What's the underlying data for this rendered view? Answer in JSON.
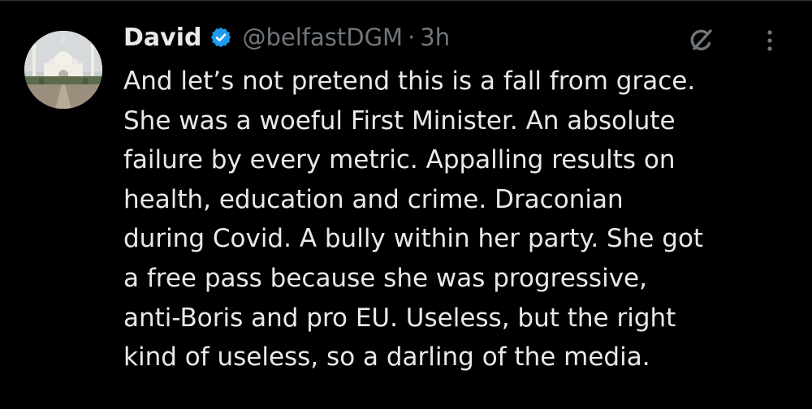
{
  "tweet": {
    "author_name": "David",
    "handle": "@belfastDGM",
    "separator": "·",
    "time": "3h",
    "verified": true,
    "lines": [
      "And let’s not pretend this is a fall from grace.",
      "She was a woeful First Minister. An absolute",
      "failure by every metric. Appalling results on",
      "health, education and crime. Draconian",
      "during Covid. A bully within her party. She got",
      "a free pass because she was progressive,",
      "anti-Boris and pro EU. Useless, but the right",
      "kind of useless, so a darling of the media."
    ]
  },
  "icons": {
    "verified": "verified-badge-icon",
    "grok": "grok-icon",
    "more": "more-options-icon"
  },
  "colors": {
    "background": "#000000",
    "text": "#e7e9ea",
    "secondary_text": "#71767b",
    "verified_blue": "#1d9bf0"
  }
}
